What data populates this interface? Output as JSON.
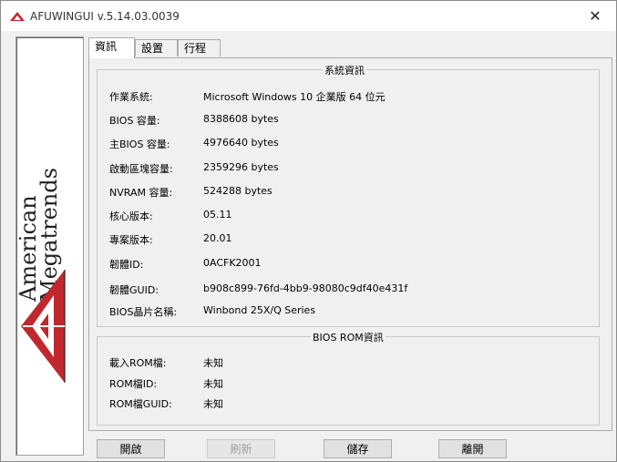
{
  "window": {
    "title": "AFUWINGUI v.5.14.03.0039",
    "close_symbol": "✕"
  },
  "logo": {
    "line1": "American",
    "line2": "Megatrends"
  },
  "tabs": [
    {
      "label": "資訊",
      "active": true
    },
    {
      "label": "設置",
      "active": false
    },
    {
      "label": "行程",
      "active": false
    }
  ],
  "system_info": {
    "legend": "系統資訊",
    "rows": [
      {
        "label": "作業系統:",
        "value": "Microsoft Windows 10 企業版 64 位元"
      },
      {
        "label": "BIOS 容量:",
        "value": "8388608 bytes"
      },
      {
        "label": "主BIOS 容量:",
        "value": "4976640 bytes"
      },
      {
        "label": "啟動區塊容量:",
        "value": "2359296 bytes"
      },
      {
        "label": "NVRAM 容量:",
        "value": "524288 bytes"
      },
      {
        "label": "核心版本:",
        "value": "05.11"
      },
      {
        "label": "專案版本:",
        "value": "20.01"
      },
      {
        "label": "韌體ID:",
        "value": "0ACFK2001"
      },
      {
        "label": "韌體GUID:",
        "value": "b908c899-76fd-4bb9-98080c9df40e431f"
      },
      {
        "label": "BIOS晶片名稱:",
        "value": "Winbond 25X/Q Series"
      }
    ]
  },
  "bios_rom_info": {
    "legend": "BIOS ROM資訊",
    "rows": [
      {
        "label": "載入ROM檔:",
        "value": "未知"
      },
      {
        "label": "ROM檔ID:",
        "value": "未知"
      },
      {
        "label": "ROM檔GUID:",
        "value": "未知"
      }
    ]
  },
  "buttons": {
    "open": "開啟",
    "refresh": "刷新",
    "save": "儲存",
    "exit": "離開"
  },
  "colors": {
    "logo_red": "#c0282d",
    "accent_border": "#adadad"
  }
}
